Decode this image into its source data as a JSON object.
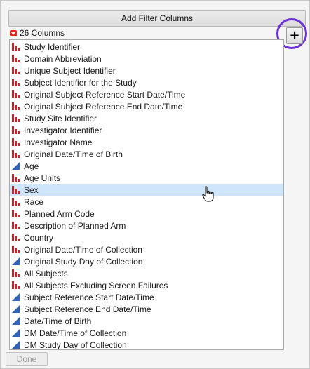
{
  "dialog": {
    "add_filter_label": "Add Filter Columns",
    "column_count_label": "26 Columns",
    "done_label": "Done"
  },
  "colors": {
    "nominal_icon": "#c0262c",
    "continuous_icon": "#2f63b8",
    "selection_bg": "#cfe5fb",
    "highlight_ring": "#6a2fd6"
  },
  "columns": [
    {
      "label": "Study Identifier",
      "icon": "nominal-icon",
      "selected": false
    },
    {
      "label": "Domain Abbreviation",
      "icon": "nominal-icon",
      "selected": false
    },
    {
      "label": "Unique Subject Identifier",
      "icon": "nominal-icon",
      "selected": false
    },
    {
      "label": "Subject Identifier for the Study",
      "icon": "nominal-icon",
      "selected": false
    },
    {
      "label": "Original Subject Reference Start Date/Time",
      "icon": "nominal-icon",
      "selected": false
    },
    {
      "label": "Original Subject Reference End Date/Time",
      "icon": "nominal-icon",
      "selected": false
    },
    {
      "label": "Study Site Identifier",
      "icon": "nominal-icon",
      "selected": false
    },
    {
      "label": "Investigator Identifier",
      "icon": "nominal-icon",
      "selected": false
    },
    {
      "label": "Investigator Name",
      "icon": "nominal-icon",
      "selected": false
    },
    {
      "label": "Original Date/Time of Birth",
      "icon": "nominal-icon",
      "selected": false
    },
    {
      "label": "Age",
      "icon": "continuous-icon",
      "selected": false
    },
    {
      "label": "Age Units",
      "icon": "nominal-icon",
      "selected": false
    },
    {
      "label": "Sex",
      "icon": "nominal-icon",
      "selected": true
    },
    {
      "label": "Race",
      "icon": "nominal-icon",
      "selected": false
    },
    {
      "label": "Planned Arm Code",
      "icon": "nominal-icon",
      "selected": false
    },
    {
      "label": "Description of Planned Arm",
      "icon": "nominal-icon",
      "selected": false
    },
    {
      "label": "Country",
      "icon": "nominal-icon",
      "selected": false
    },
    {
      "label": "Original Date/Time of Collection",
      "icon": "nominal-icon",
      "selected": false
    },
    {
      "label": "Original Study Day of Collection",
      "icon": "continuous-icon",
      "selected": false
    },
    {
      "label": "All Subjects",
      "icon": "nominal-icon",
      "selected": false
    },
    {
      "label": "All Subjects Excluding Screen Failures",
      "icon": "nominal-icon",
      "selected": false
    },
    {
      "label": "Subject Reference Start Date/Time",
      "icon": "continuous-icon",
      "selected": false
    },
    {
      "label": "Subject Reference End Date/Time",
      "icon": "continuous-icon",
      "selected": false
    },
    {
      "label": "Date/Time of Birth",
      "icon": "continuous-icon",
      "selected": false
    },
    {
      "label": "DM Date/Time of Collection",
      "icon": "continuous-icon",
      "selected": false
    },
    {
      "label": "DM Study Day of Collection",
      "icon": "continuous-icon",
      "selected": false
    }
  ]
}
